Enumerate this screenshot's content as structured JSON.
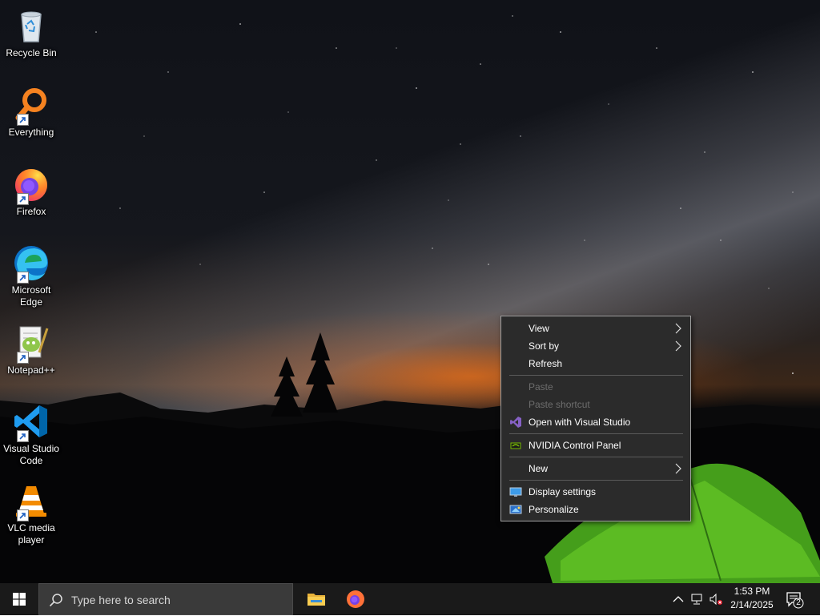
{
  "desktop": {
    "icons": [
      {
        "label": "Recycle Bin",
        "icon": "recycle-bin-icon"
      },
      {
        "label": "Everything",
        "icon": "everything-search-icon"
      },
      {
        "label": "Firefox",
        "icon": "firefox-icon"
      },
      {
        "label": "Microsoft Edge",
        "icon": "edge-icon"
      },
      {
        "label": "Notepad++",
        "icon": "notepadpp-icon"
      },
      {
        "label": "Visual Studio Code",
        "icon": "vscode-icon"
      },
      {
        "label": "VLC media player",
        "icon": "vlc-icon"
      }
    ]
  },
  "context_menu": {
    "items": [
      {
        "label": "View",
        "submenu": true,
        "enabled": true
      },
      {
        "label": "Sort by",
        "submenu": true,
        "enabled": true
      },
      {
        "label": "Refresh",
        "enabled": true
      },
      {
        "label": "Paste",
        "enabled": false
      },
      {
        "label": "Paste shortcut",
        "enabled": false
      },
      {
        "label": "Open with Visual Studio",
        "icon": "visual-studio-icon",
        "enabled": true
      },
      {
        "label": "NVIDIA Control Panel",
        "icon": "nvidia-icon",
        "enabled": true
      },
      {
        "label": "New",
        "submenu": true,
        "enabled": true
      },
      {
        "label": "Display settings",
        "icon": "display-icon",
        "enabled": true
      },
      {
        "label": "Personalize",
        "icon": "personalize-icon",
        "enabled": true
      }
    ]
  },
  "taskbar": {
    "search_placeholder": "Type here to search",
    "pinned": [
      "file-explorer-icon",
      "firefox-icon"
    ],
    "clock": {
      "time": "1:53 PM",
      "date": "2/14/2025"
    },
    "notification_count": "2"
  },
  "colors": {
    "menu_bg": "#2b2b2b",
    "taskbar_bg": "#1a1a1a",
    "search_bg": "#3a3a3a",
    "disabled_text": "#6d6d6d"
  }
}
